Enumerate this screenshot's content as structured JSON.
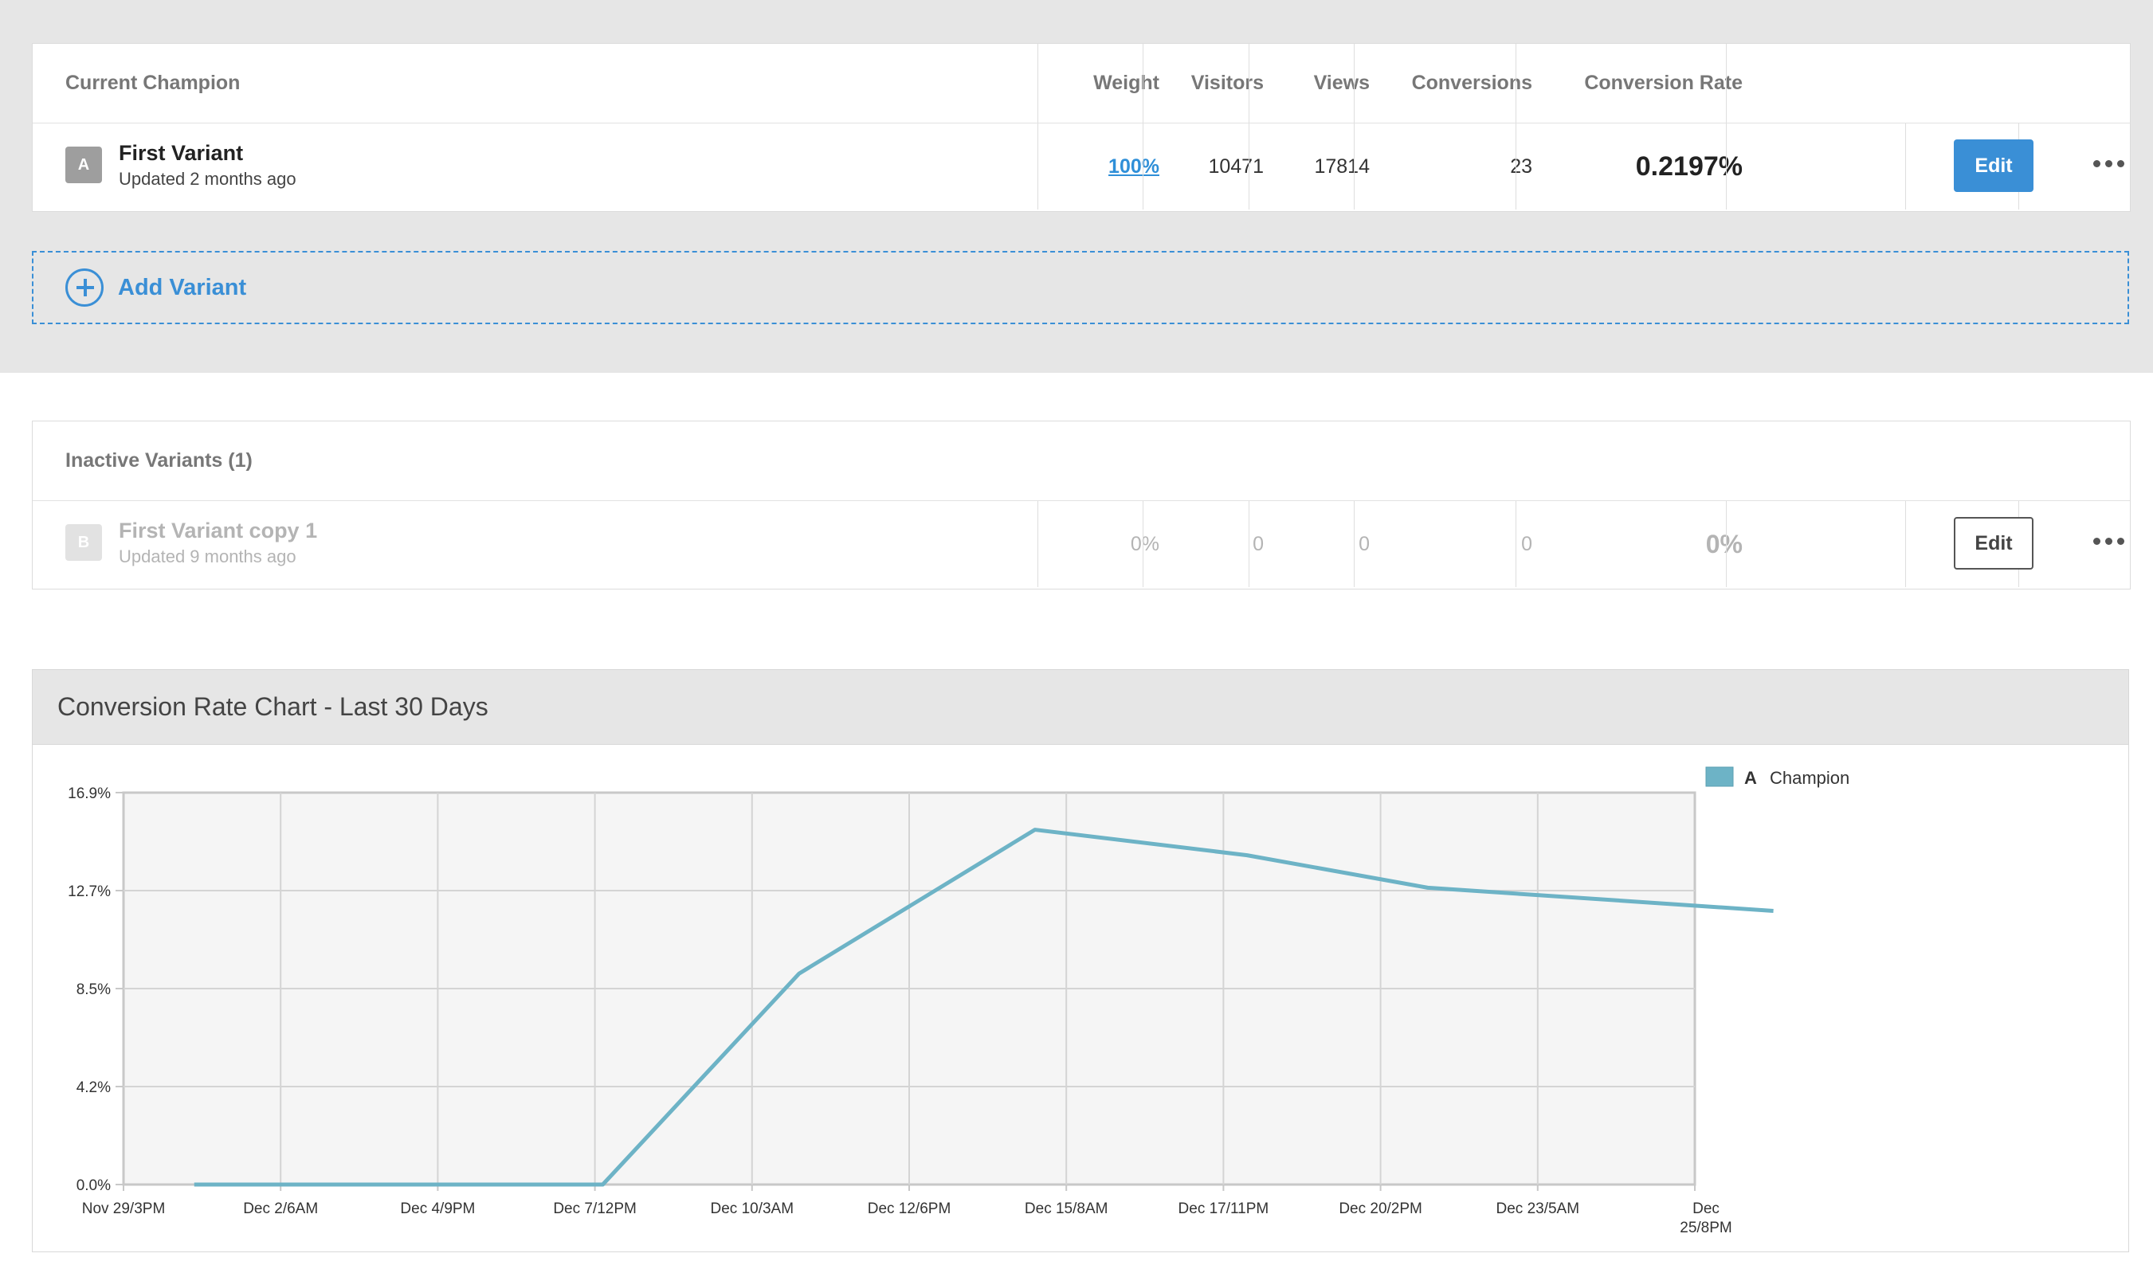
{
  "champion_table": {
    "headers": {
      "name": "Current Champion",
      "weight": "Weight",
      "visitors": "Visitors",
      "views": "Views",
      "conversions": "Conversions",
      "conversion_rate": "Conversion Rate"
    },
    "row": {
      "badge": "A",
      "name": "First Variant",
      "updated": "Updated 2 months ago",
      "weight": "100%",
      "visitors": "10471",
      "views": "17814",
      "conversions": "23",
      "conversion_rate": "0.2197%",
      "edit_label": "Edit"
    }
  },
  "add_variant": {
    "label": "Add Variant"
  },
  "inactive_table": {
    "title": "Inactive Variants (1)",
    "row": {
      "badge": "B",
      "name": "First Variant copy 1",
      "updated": "Updated 9 months ago",
      "weight": "0%",
      "visitors": "0",
      "views": "0",
      "conversions": "0",
      "conversion_rate": "0%",
      "edit_label": "Edit"
    }
  },
  "colors": {
    "accent": "#3a8fd6",
    "series": "#6db3c6",
    "badge_active": "#9e9e9e",
    "badge_inactive": "#e2e2e2"
  },
  "chart_data": {
    "type": "line",
    "title": "Conversion Rate Chart - Last 30 Days",
    "y_ticks": [
      "0.0%",
      "4.2%",
      "8.5%",
      "12.7%",
      "16.9%"
    ],
    "ylim": [
      0,
      16.9
    ],
    "x_ticks": [
      "Nov 29/3PM",
      "Dec 2/6AM",
      "Dec 4/9PM",
      "Dec 7/12PM",
      "Dec 10/3AM",
      "Dec 12/6PM",
      "Dec 15/8AM",
      "Dec 17/11PM",
      "Dec 20/2PM",
      "Dec 23/5AM",
      "Dec 25/8PM"
    ],
    "grid": true,
    "legend": {
      "position": "right",
      "marker": "A",
      "label": "Champion"
    },
    "series": [
      {
        "name": "Champion",
        "x": [
          0.45,
          3.05,
          4.3,
          5.8,
          7.15,
          8.3,
          10.5
        ],
        "y": [
          0.0,
          0.0,
          9.1,
          15.3,
          14.2,
          12.8,
          11.8
        ]
      }
    ]
  }
}
